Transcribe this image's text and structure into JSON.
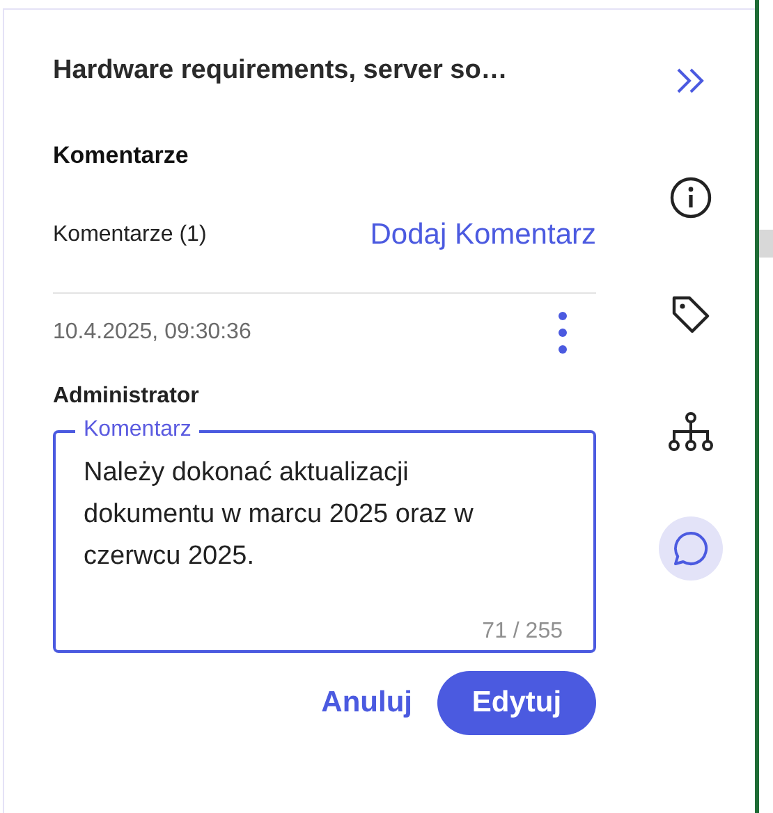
{
  "header": {
    "title": "Hardware requirements, server so…"
  },
  "rail": [
    {
      "kind": "collapse",
      "selected": false
    },
    {
      "kind": "info",
      "selected": false
    },
    {
      "kind": "tag",
      "selected": false
    },
    {
      "kind": "hierarchy",
      "selected": false
    },
    {
      "kind": "comment",
      "selected": true
    }
  ],
  "section": {
    "heading": "Komentarze",
    "count_label": "Komentarze (1)",
    "add_link": "Dodaj Komentarz"
  },
  "comment": {
    "timestamp": "10.4.2025, 09:30:36",
    "author": "Administrator",
    "field": {
      "label": "Komentarz",
      "value": "Należy dokonać aktualizacji dokumentu w marcu 2025 oraz w czerwcu 2025.",
      "counter": "71 / 255"
    }
  },
  "buttons": [
    {
      "kind": "text",
      "label": "Anuluj"
    },
    {
      "kind": "filled",
      "label": "Edytuj"
    }
  ]
}
